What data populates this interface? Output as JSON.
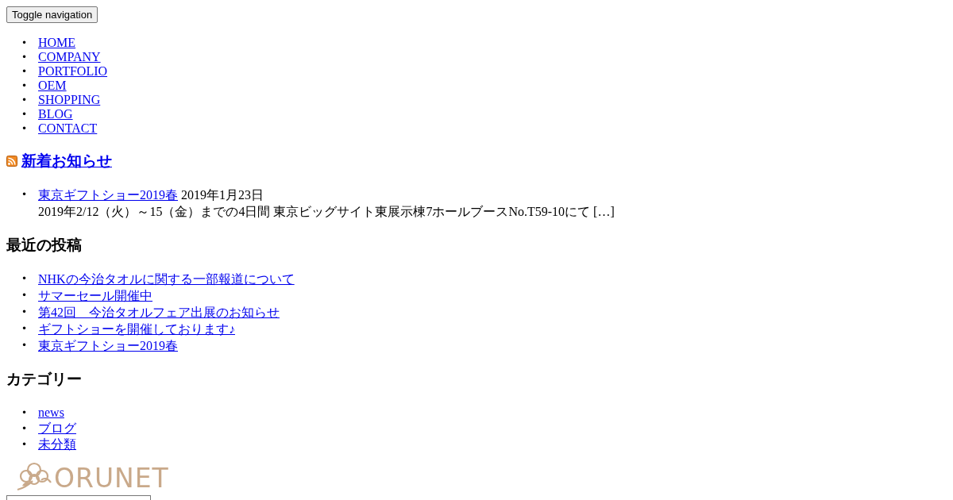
{
  "toggle_button": {
    "label": "Toggle navigation"
  },
  "nav": {
    "items": [
      {
        "marker": "•",
        "label": "HOME"
      },
      {
        "marker": "•",
        "label": "COMPANY"
      },
      {
        "marker": "•",
        "label": "PORTFOLIO"
      },
      {
        "marker": "•",
        "label": "OEM"
      },
      {
        "marker": "•",
        "label": "SHOPPING"
      },
      {
        "marker": "•",
        "label": "BLOG"
      },
      {
        "marker": "•",
        "label": "CONTACT"
      }
    ]
  },
  "news": {
    "title": "新着お知らせ",
    "items": [
      {
        "marker": "•",
        "title": "東京ギフトショー2019春",
        "date": "2019年1月23日",
        "excerpt": "2019年2/12（火）～15（金）までの4日間 東京ビッグサイト東展示棟7ホールブースNo.T59-10にて […]"
      }
    ]
  },
  "recent_posts": {
    "title": "最近の投稿",
    "items": [
      {
        "marker": "•",
        "label": "NHKの今治タオルに関する一部報道について"
      },
      {
        "marker": "•",
        "label": "サマーセール開催中"
      },
      {
        "marker": "•",
        "label": "第42回　今治タオルフェア出展のお知らせ"
      },
      {
        "marker": "•",
        "label": "ギフトショーを開催しております♪"
      },
      {
        "marker": "•",
        "label": "東京ギフトショー2019春"
      }
    ]
  },
  "categories": {
    "title": "カテゴリー",
    "items": [
      {
        "marker": "•",
        "label": "news"
      },
      {
        "marker": "•",
        "label": "ブログ"
      },
      {
        "marker": "•",
        "label": "未分類"
      }
    ]
  },
  "logo": {
    "text": "ORUNET"
  },
  "search_field": {
    "kind": "input"
  }
}
